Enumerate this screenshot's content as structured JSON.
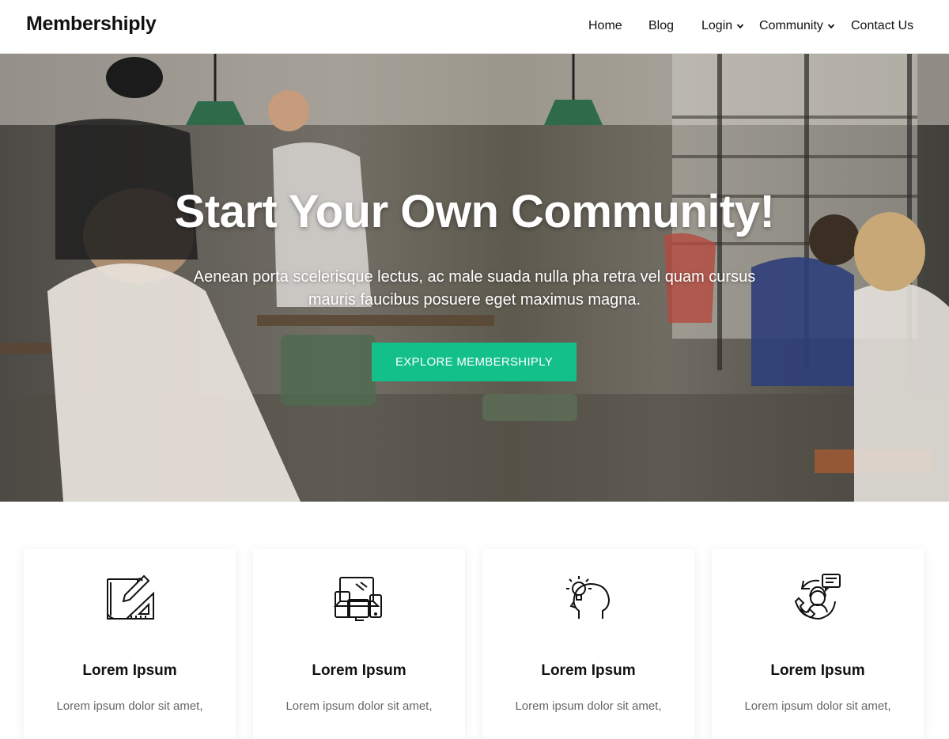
{
  "header": {
    "logo": "Membershiply",
    "nav": [
      {
        "label": "Home"
      },
      {
        "label": "Blog"
      },
      {
        "label": "Login",
        "has_dropdown": true
      },
      {
        "label": "Community",
        "has_dropdown": true
      },
      {
        "label": "Contact Us"
      }
    ]
  },
  "hero": {
    "title": "Start Your Own Community!",
    "subtitle": "Aenean porta scelerisque lectus, ac male suada nulla pha retra vel quam cursus mauris faucibus posuere eget maximus magna.",
    "cta_label": "EXPLORE MEMBERSHIPLY",
    "cta_color": "#14c08a"
  },
  "features": [
    {
      "icon": "blueprint-design-icon",
      "title": "Lorem Ipsum",
      "text": "Lorem ipsum dolor sit amet,"
    },
    {
      "icon": "devices-icon",
      "title": "Lorem Ipsum",
      "text": "Lorem ipsum dolor sit amet,"
    },
    {
      "icon": "head-idea-lightbulb-icon",
      "title": "Lorem Ipsum",
      "text": "Lorem ipsum dolor sit amet,"
    },
    {
      "icon": "customer-support-icon",
      "title": "Lorem Ipsum",
      "text": "Lorem ipsum dolor sit amet,"
    }
  ]
}
